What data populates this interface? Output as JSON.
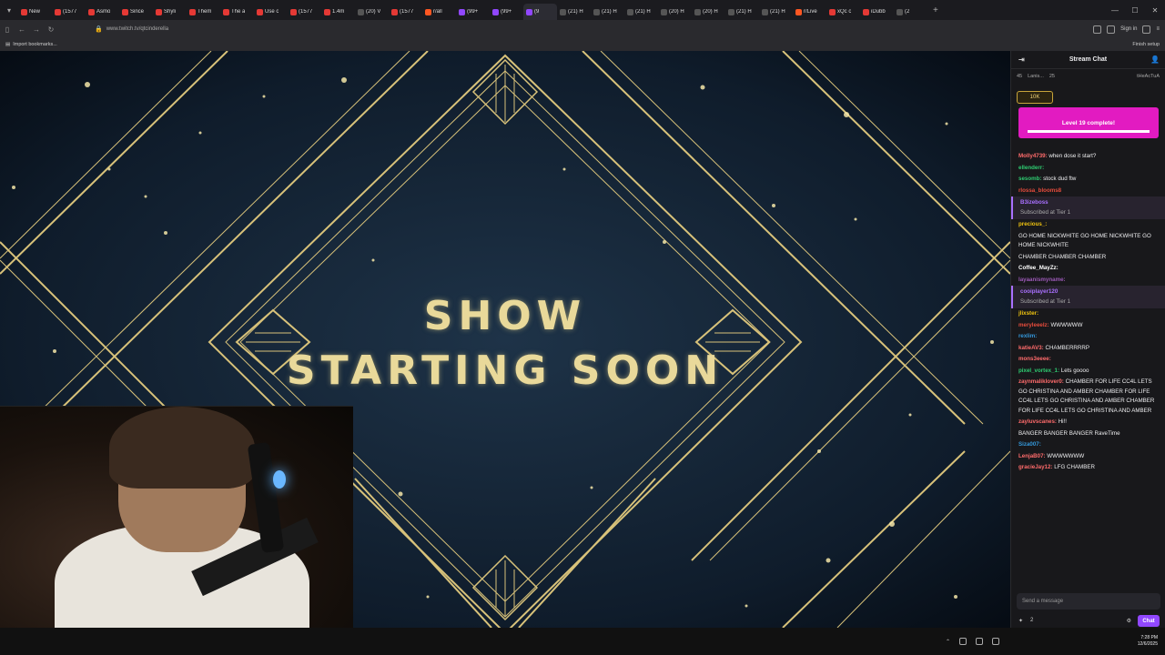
{
  "browser": {
    "tabs": [
      {
        "label": "New",
        "color": "#e53935"
      },
      {
        "label": "(1577",
        "color": "#e53935"
      },
      {
        "label": "Asmo",
        "color": "#e53935"
      },
      {
        "label": "Since",
        "color": "#e53935"
      },
      {
        "label": "Shyli",
        "color": "#e53935"
      },
      {
        "label": "Them",
        "color": "#e53935"
      },
      {
        "label": "The a",
        "color": "#e53935"
      },
      {
        "label": "Use c",
        "color": "#e53935"
      },
      {
        "label": "(1577",
        "color": "#e53935"
      },
      {
        "label": "1.4m",
        "color": "#e53935"
      },
      {
        "label": "(20) V",
        "color": "#555"
      },
      {
        "label": "(1577",
        "color": "#e53935"
      },
      {
        "label": "r/all",
        "color": "#ff5722"
      },
      {
        "label": "(99+",
        "color": "#9147ff"
      },
      {
        "label": "(99+",
        "color": "#9147ff"
      },
      {
        "label": "(9",
        "color": "#9147ff",
        "active": true
      },
      {
        "label": "(21) H",
        "color": "#555"
      },
      {
        "label": "(21) H",
        "color": "#555"
      },
      {
        "label": "(21) H",
        "color": "#555"
      },
      {
        "label": "(20) H",
        "color": "#555"
      },
      {
        "label": "(20) H",
        "color": "#555"
      },
      {
        "label": "(21) H",
        "color": "#555"
      },
      {
        "label": "(21) H",
        "color": "#555"
      },
      {
        "label": "r/Live",
        "color": "#ff5722"
      },
      {
        "label": "xQc c",
        "color": "#e53935"
      },
      {
        "label": "iDubb",
        "color": "#e53935"
      },
      {
        "label": "(2",
        "color": "#555"
      }
    ],
    "url": "www.twitch.tv/qtcinderella",
    "sign_in": "Sign in",
    "import_bookmarks": "Import bookmarks...",
    "finish_setup": "Finish setup"
  },
  "stream": {
    "title_line1": "SHOW",
    "title_line2": "STARTING SOON"
  },
  "chat": {
    "header": "Stream Chat",
    "leaderboard": [
      {
        "rank": "45"
      },
      {
        "name": "Lanis...",
        "value": "25"
      },
      {
        "name": "tHeAcTuA"
      }
    ],
    "hype_train": "10K",
    "level_banner": "Level 19 complete!",
    "level_progress": 1.0,
    "messages": [
      {
        "user": "Molly4739:",
        "color": "#ff6b6b",
        "text": " when dose it start?"
      },
      {
        "user": "ellenderr:",
        "color": "#2ecc71",
        "text": ""
      },
      {
        "user": "sesomb:",
        "color": "#2ecc71",
        "text": " stock dud ftw"
      },
      {
        "user": "rlossa_blooms8",
        "color": "#e74c3c",
        "text": ""
      },
      {
        "user": "B3izeboss",
        "color": "#a970ff",
        "text": "",
        "sub": "Subscribed at Tier 1"
      },
      {
        "user": "precious_:",
        "color": "#f1c40f",
        "text": ""
      },
      {
        "user": "",
        "color": "#3498db",
        "text": " GO HOME NICKWHITE GO HOME NICKWHITE GO HOME NICKWHITE"
      },
      {
        "user": "",
        "color": "#3498db",
        "text": " CHAMBER CHAMBER CHAMBER"
      },
      {
        "user": "Coffee_MayZz:",
        "color": "#ffffff",
        "text": ""
      },
      {
        "user": "layaanismyname:",
        "color": "#9b59b6",
        "text": ""
      },
      {
        "user": "cooiplayer120",
        "color": "#a970ff",
        "text": "",
        "sub": "Subscribed at Tier 1"
      },
      {
        "user": "jlixster:",
        "color": "#f1c40f",
        "text": ""
      },
      {
        "user": "meryleeelz:",
        "color": "#e74c3c",
        "text": " WWWWWW"
      },
      {
        "user": "rexlim:",
        "color": "#3498db",
        "text": ""
      },
      {
        "user": "katieAV3:",
        "color": "#ff6b6b",
        "text": " CHAMBERRRRP"
      },
      {
        "user": "mons3eeee:",
        "color": "#ff6b6b",
        "text": ""
      },
      {
        "user": "pixel_vortex_1:",
        "color": "#2ecc71",
        "text": " Lets goooo"
      },
      {
        "user": "zaynmaliklover0:",
        "color": "#ff6b6b",
        "text": " CHAMBER FOR LIFE CC4L LETS GO CHRISTINA AND AMBER CHAMBER FOR LIFE CC4L LETS GO CHRISTINA AND AMBER CHAMBER FOR LIFE CC4L LETS GO CHRISTINA AND AMBER"
      },
      {
        "user": "zayluvscanes:",
        "color": "#ff6b6b",
        "text": " Hi!!"
      },
      {
        "user": "",
        "color": "#9147ff",
        "text": " BANGER BANGER BANGER RaveTime"
      },
      {
        "user": "Siza007:",
        "color": "#3498db",
        "text": ""
      },
      {
        "user": "LenjaB07:",
        "color": "#ff6b6b",
        "text": " WWWWWWW"
      },
      {
        "user": "gracieJay12:",
        "color": "#ff6b6b",
        "text": " LFG CHAMBER"
      }
    ],
    "input_placeholder": "Send a message",
    "points": "2",
    "chat_button": "Chat"
  },
  "system": {
    "time": "7:28 PM",
    "date": "12/6/2025"
  }
}
